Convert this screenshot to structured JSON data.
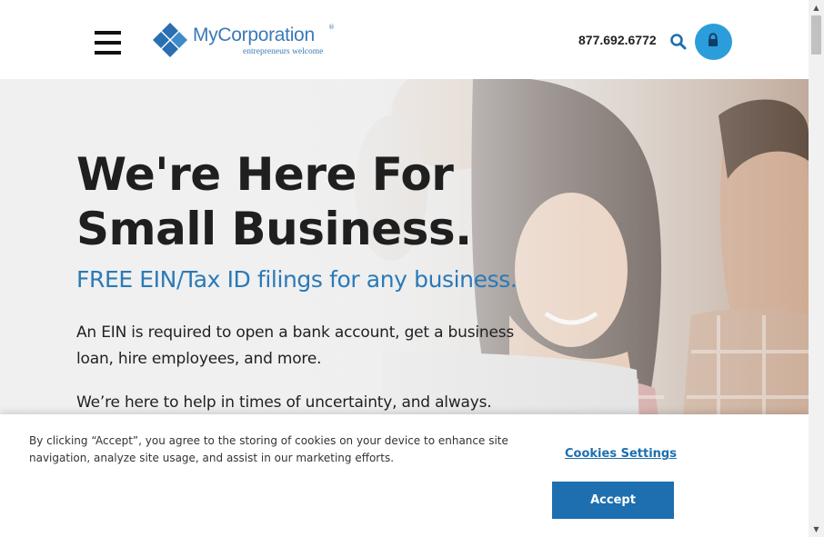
{
  "header": {
    "logo_name": "MyCorporation",
    "logo_reg": "®",
    "logo_tagline": "entrepreneurs welcome",
    "phone": "877.692.6772",
    "icons": {
      "menu": "hamburger-menu-icon",
      "search": "search-icon",
      "account": "lock-icon"
    }
  },
  "hero": {
    "title": "We're Here For Small Business.",
    "subtitle": "FREE EIN/Tax ID filings for any business.",
    "paragraph1": "An EIN is required to open a bank account, get a business loan, hire employees, and more.",
    "paragraph2": "We’re here to help in times of uncertainty, and always."
  },
  "cookie_banner": {
    "text": "By clicking “Accept”, you agree to the storing of cookies on your device to enhance site navigation, analyze site usage, and assist in our marketing efforts.",
    "settings_label": "Cookies Settings",
    "accept_label": "Accept"
  },
  "scrollbar": {
    "up_arrow": "▲",
    "down_arrow": "▼"
  },
  "colors": {
    "brand_blue": "#3a7ab8",
    "subtitle_blue": "#2a7ab8",
    "accent_button": "#1d6fb0",
    "lock_button": "#2c9ddb"
  }
}
